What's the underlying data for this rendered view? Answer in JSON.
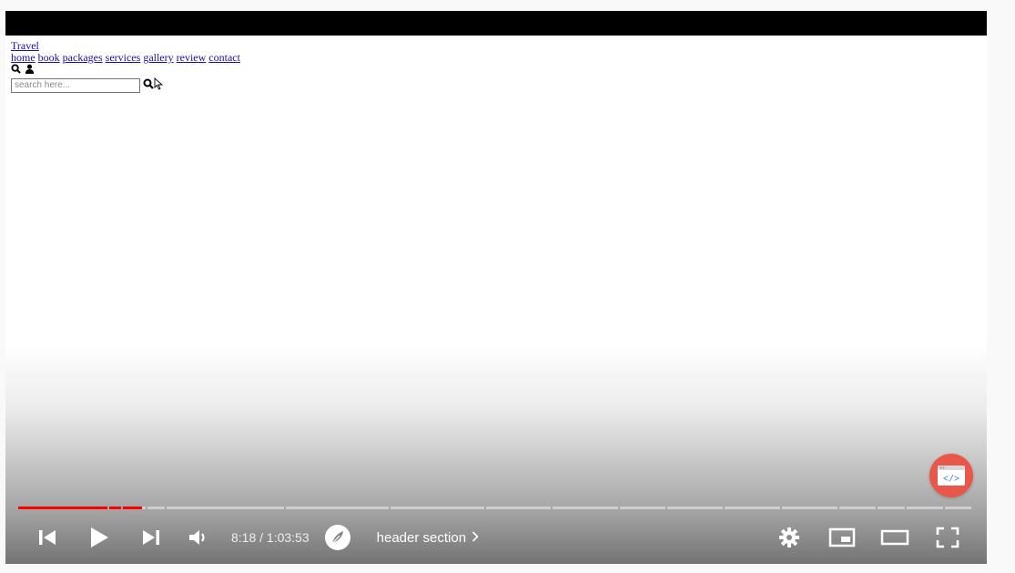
{
  "page": {
    "logo_text": "Travel",
    "nav": [
      "home",
      "book",
      "packages",
      "services",
      "gallery",
      "review",
      "contact"
    ],
    "search_placeholder": "search here..."
  },
  "player": {
    "current_time": "8:18",
    "duration": "1:03:53",
    "time_separator": " / ",
    "chapter_title": "header section",
    "progress": 0.13,
    "accent_color": "#ff0000",
    "badge_color": "#e8574a",
    "badge_text": "</>"
  },
  "icons": {
    "prev": "skip-previous-icon",
    "play": "play-icon",
    "next": "skip-next-icon",
    "volume": "volume-icon",
    "chapter_logo": "feather-icon",
    "settings": "gear-icon",
    "miniplayer": "miniplayer-icon",
    "theater": "theater-mode-icon",
    "fullscreen": "fullscreen-icon"
  }
}
